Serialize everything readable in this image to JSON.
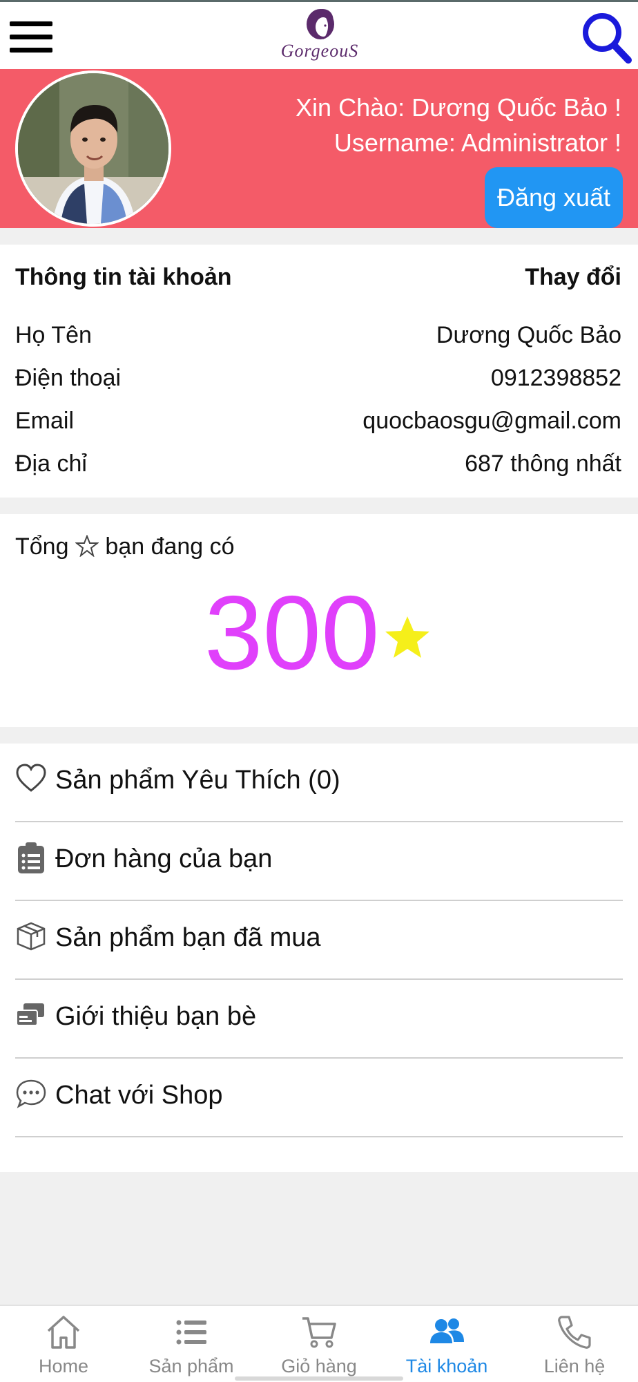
{
  "header": {
    "logo_text": "GorgeouS",
    "menu_icon": "hamburger-menu-icon",
    "search_icon": "search-icon"
  },
  "profile": {
    "greeting": "Xin Chào: Dương Quốc Bảo !",
    "username": "Username: Administrator !",
    "logout_label": "Đăng xuất"
  },
  "account": {
    "title": "Thông tin tài khoản",
    "edit_label": "Thay đổi",
    "rows": [
      {
        "label": "Họ Tên",
        "value": "Dương Quốc Bảo"
      },
      {
        "label": "Điện thoại",
        "value": "0912398852"
      },
      {
        "label": "Email",
        "value": "quocbaosgu@gmail.com"
      },
      {
        "label": "Địa chỉ",
        "value": "687 thông nhất"
      }
    ]
  },
  "stars": {
    "label_prefix": "Tổng",
    "label_suffix": "bạn đang có",
    "value": "300"
  },
  "menu": [
    {
      "label": "Sản phẩm Yêu Thích (0)",
      "icon": "heart-icon"
    },
    {
      "label": "Đơn hàng của bạn",
      "icon": "clipboard-list-icon"
    },
    {
      "label": "Sản phẩm bạn đã mua",
      "icon": "box-icon"
    },
    {
      "label": "Giới thiệu bạn bè",
      "icon": "share-cards-icon"
    },
    {
      "label": "Chat với Shop",
      "icon": "chat-bubble-icon"
    }
  ],
  "nav": [
    {
      "label": "Home",
      "icon": "home-icon"
    },
    {
      "label": "Sản phẩm",
      "icon": "list-icon"
    },
    {
      "label": "Giỏ hàng",
      "icon": "cart-icon"
    },
    {
      "label": "Tài khoản",
      "icon": "users-icon",
      "active": true
    },
    {
      "label": "Liên hệ",
      "icon": "phone-icon"
    }
  ],
  "colors": {
    "banner": "#f45b68",
    "logout_button": "#2196f3",
    "star_value": "#e040fb",
    "star_icon": "#f5ef1a",
    "active_nav": "#1e88e5",
    "search_icon": "#1a1adb"
  }
}
